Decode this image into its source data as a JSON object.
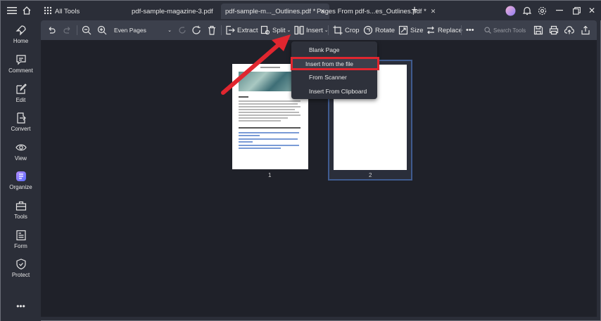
{
  "titlebar": {
    "all_tools": "All Tools",
    "tabs": [
      {
        "label": "pdf-sample-magazine-3.pdf"
      },
      {
        "label": "pdf-sample-m..._Outlines.pdf *"
      },
      {
        "label": "Pages From pdf-s...es_Outlines.pdf *"
      }
    ]
  },
  "sidebar": {
    "items": [
      {
        "label": "Home",
        "icon": "rocket-icon"
      },
      {
        "label": "Comment",
        "icon": "comment-icon"
      },
      {
        "label": "Edit",
        "icon": "edit-icon"
      },
      {
        "label": "Convert",
        "icon": "convert-icon"
      },
      {
        "label": "View",
        "icon": "eye-icon"
      },
      {
        "label": "Organize",
        "icon": "organize-icon"
      },
      {
        "label": "Tools",
        "icon": "toolbox-icon"
      },
      {
        "label": "Form",
        "icon": "form-icon"
      },
      {
        "label": "Protect",
        "icon": "shield-icon"
      }
    ]
  },
  "toolbar": {
    "page_filter": "Even Pages",
    "extract": "Extract",
    "split": "Split",
    "insert": "Insert",
    "crop": "Crop",
    "rotate": "Rotate",
    "size": "Size",
    "replace": "Replace",
    "search_placeholder": "Search Tools"
  },
  "insert_menu": {
    "items": [
      {
        "label": "Blank Page"
      },
      {
        "label": "Insert from the file"
      },
      {
        "label": "From Scanner"
      },
      {
        "label": "Insert From Clipboard"
      }
    ]
  },
  "pages": [
    {
      "number": "1"
    },
    {
      "number": "2"
    }
  ],
  "colors": {
    "accent_highlight": "#e0262f",
    "annotation_arrow": "#e0262f",
    "selected_page_border": "#3f5b8f"
  }
}
